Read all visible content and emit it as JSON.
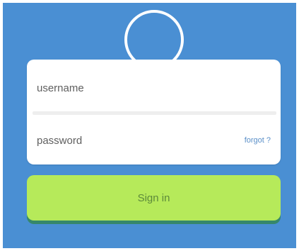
{
  "colors": {
    "background": "#4a8fd3",
    "card": "#ffffff",
    "divider": "#eeeeee",
    "link": "#5a8fc8",
    "button": "#b6ea5a",
    "button_shadow": "#36876b",
    "button_text": "#5d8a3a"
  },
  "avatar": {
    "icon": "avatar-ring"
  },
  "login_form": {
    "username": {
      "placeholder": "username",
      "value": ""
    },
    "password": {
      "placeholder": "password",
      "value": ""
    },
    "forgot_label": "forgot ?"
  },
  "signin_button": {
    "label": "Sign in"
  }
}
